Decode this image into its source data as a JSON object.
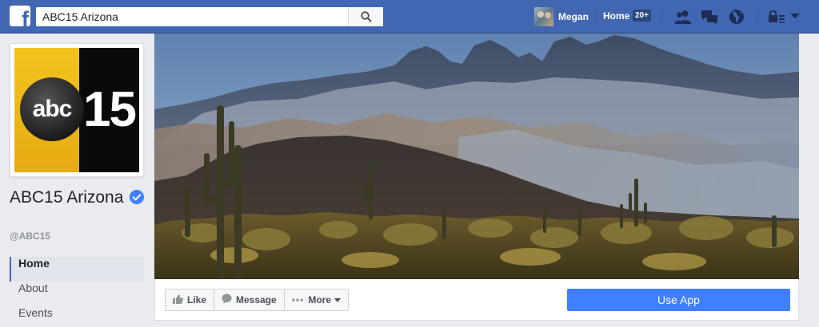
{
  "topbar": {
    "logo_letter": "f",
    "search_value": "ABC15 Arizona",
    "user_name": "Megan",
    "home_label": "Home",
    "home_badge": "20+",
    "icons": [
      "friend-requests-icon",
      "messages-icon",
      "notifications-globe-icon",
      "privacy-lock-icon",
      "account-menu-caret-icon"
    ],
    "brand_color": "#4267b2"
  },
  "page": {
    "logo_text": "abc",
    "logo_number": "15",
    "name": "ABC15 Arizona",
    "handle": "@ABC15",
    "verified": true
  },
  "nav": {
    "items": [
      {
        "label": "Home",
        "active": true
      },
      {
        "label": "About",
        "active": false
      },
      {
        "label": "Events",
        "active": false
      }
    ]
  },
  "actions": {
    "like_label": "Like",
    "message_label": "Message",
    "more_label": "More",
    "use_app_label": "Use App",
    "use_app_color": "#4080ff"
  }
}
